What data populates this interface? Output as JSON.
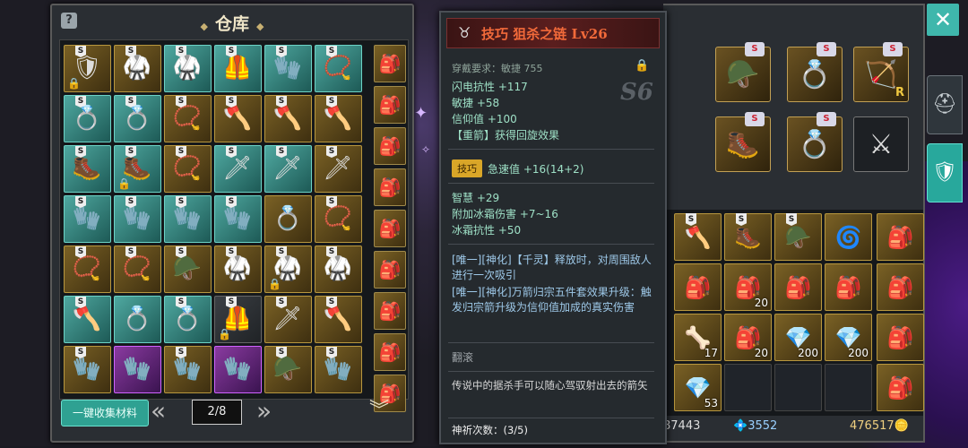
{
  "warehouse": {
    "title": "仓库",
    "help_icon": "question-icon",
    "collect_label": "一键收集材料",
    "page_indicator": "2/8",
    "rows": [
      [
        {
          "c": "gold",
          "i": "🛡",
          "s": true,
          "lock": true
        },
        {
          "c": "gold",
          "i": "🥋",
          "s": true
        },
        {
          "c": "teal",
          "i": "🥋",
          "s": true
        },
        {
          "c": "teal",
          "i": "🦺",
          "s": true
        },
        {
          "c": "teal",
          "i": "🧤",
          "s": true
        },
        {
          "c": "teal",
          "i": "📿",
          "s": true
        }
      ],
      [
        {
          "c": "teal",
          "i": "💍",
          "s": true
        },
        {
          "c": "teal",
          "i": "💍",
          "s": true
        },
        {
          "c": "gold",
          "i": "📿",
          "s": true
        },
        {
          "c": "gold",
          "i": "🪓",
          "s": true
        },
        {
          "c": "gold",
          "i": "🪓",
          "s": true
        },
        {
          "c": "gold",
          "i": "🪓",
          "s": true
        }
      ],
      [
        {
          "c": "teal",
          "i": "🥾",
          "s": true
        },
        {
          "c": "teal",
          "i": "🥾",
          "s": true,
          "lock": true
        },
        {
          "c": "gold",
          "i": "📿",
          "s": true
        },
        {
          "c": "teal",
          "i": "🗡",
          "s": true
        },
        {
          "c": "teal",
          "i": "🗡",
          "s": true
        },
        {
          "c": "gold",
          "i": "🗡",
          "s": true
        }
      ],
      [
        {
          "c": "teal",
          "i": "🧤",
          "s": true
        },
        {
          "c": "teal",
          "i": "🧤",
          "s": true
        },
        {
          "c": "teal",
          "i": "🧤",
          "s": true
        },
        {
          "c": "teal",
          "i": "🧤",
          "s": true
        },
        {
          "c": "gold",
          "i": "💍",
          "s": false
        },
        {
          "c": "gold",
          "i": "📿",
          "s": true
        }
      ],
      [
        {
          "c": "gold",
          "i": "📿",
          "s": true
        },
        {
          "c": "gold",
          "i": "📿",
          "s": true
        },
        {
          "c": "gold",
          "i": "🪖",
          "s": true
        },
        {
          "c": "gold",
          "i": "🥋",
          "s": true
        },
        {
          "c": "gold",
          "i": "🥋",
          "s": true,
          "lock": true
        },
        {
          "c": "gold",
          "i": "🥋",
          "s": true
        }
      ],
      [
        {
          "c": "teal",
          "i": "🪓",
          "s": true
        },
        {
          "c": "teal",
          "i": "💍",
          "s": false
        },
        {
          "c": "teal",
          "i": "💍",
          "s": true
        },
        {
          "c": "dark",
          "i": "🦺",
          "s": true,
          "lock": true
        },
        {
          "c": "gold",
          "i": "🗡",
          "s": true
        },
        {
          "c": "gold",
          "i": "🪓",
          "s": true
        }
      ],
      [
        {
          "c": "gold",
          "i": "🧤",
          "s": true
        },
        {
          "c": "purple",
          "i": "🧤",
          "s": false
        },
        {
          "c": "gold",
          "i": "🧤",
          "s": true
        },
        {
          "c": "purple",
          "i": "🧤",
          "s": false
        },
        {
          "c": "gold",
          "i": "🪖",
          "s": true
        },
        {
          "c": "gold",
          "i": "🧤",
          "s": true
        }
      ]
    ],
    "side_bags": 9
  },
  "tooltip": {
    "category": "技巧",
    "item_name": "狙杀之链",
    "level": "Lv26",
    "requirement": "穿戴要求：敏捷 755",
    "grade": "S6",
    "base_stats": [
      "闪电抗性 +117",
      "敏捷 +58",
      "信仰值 +100",
      "【重箭】获得回旋效果"
    ],
    "skill_badge": "技巧",
    "skill_text": "急速值 +16(14+2)",
    "extra_stats": [
      "智慧 +29",
      "附加冰霜伤害 +7~16",
      "冰霜抗性 +50"
    ],
    "set_desc_1": "[唯一][神化]【千灵】释放时，对周围敌人进行一次吸引",
    "set_desc_2": "[唯一][神化]万箭归宗五件套效果升级：触发归宗箭升级为信仰值加成的真实伤害",
    "flip_label": "翻滚",
    "lore": "传说中的据杀手可以随心驾驭射出去的箭矢",
    "pray_count": "神祈次数：(3/5)"
  },
  "equipment": {
    "r_tag": "R",
    "slots": [
      {
        "i": "🪖",
        "s": true
      },
      {
        "i": "💍",
        "s": true
      },
      {
        "i": "🏹",
        "s": true
      },
      {
        "i": "🥾",
        "s": true
      },
      {
        "i": "💍",
        "s": true
      },
      {
        "i": "⚔",
        "empty": true
      }
    ]
  },
  "bag": {
    "cells": [
      {
        "i": "🪓",
        "t": "gold",
        "s": true
      },
      {
        "i": "🥾",
        "t": "gold",
        "s": true
      },
      {
        "i": "🪖",
        "t": "gold",
        "s": true
      },
      {
        "i": "🌀",
        "t": "gold"
      },
      {
        "i": "🎒",
        "t": "gold"
      },
      {
        "i": "🎒",
        "t": "gold",
        "n": "20"
      },
      {
        "i": "🎒",
        "t": "gold"
      },
      {
        "i": "🎒",
        "t": "gold"
      },
      {
        "i": "🦴",
        "t": "gold",
        "n": "17"
      },
      {
        "i": "🎒",
        "t": "gold",
        "n": "20"
      },
      {
        "i": "💎",
        "t": "gold",
        "n": "200"
      },
      {
        "i": "💎",
        "t": "gold",
        "n": "200"
      },
      {
        "i": "💎",
        "t": "gold",
        "n": "53"
      },
      {
        "i": "",
        "t": "empty"
      },
      {
        "i": "",
        "t": "empty"
      },
      {
        "i": "",
        "t": "empty"
      }
    ]
  },
  "currency": {
    "a": "87443",
    "b": "3552",
    "c": "476517"
  },
  "close_label": "✕"
}
